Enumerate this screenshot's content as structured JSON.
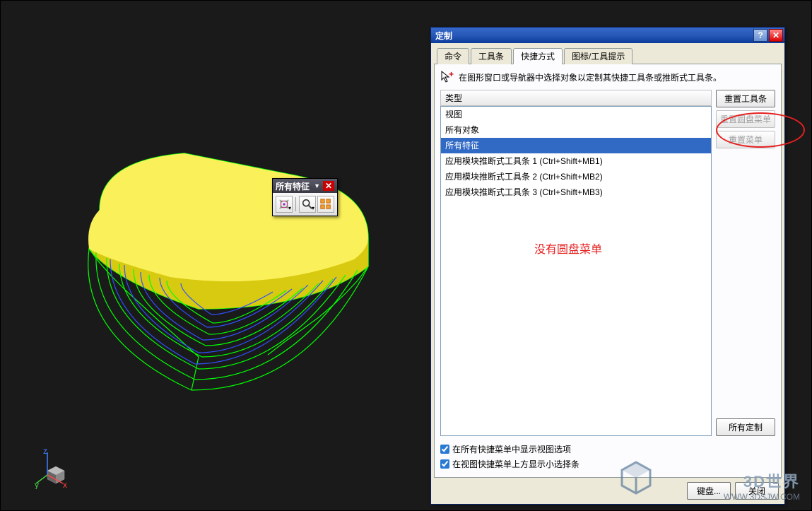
{
  "floatToolbar": {
    "title": "所有特征"
  },
  "dialog": {
    "title": "定制",
    "tabs": [
      "命令",
      "工具条",
      "快捷方式",
      "图标/工具提示"
    ],
    "activeTab": 2,
    "instruction": "在图形窗口或导航器中选择对象以定制其快捷工具条或推断式工具条。",
    "listHeader": "类型",
    "items": {
      "r0": "视图",
      "r1": "所有对象",
      "r2": "所有特征",
      "r3": "应用模块推断式工具条 1 (Ctrl+Shift+MB1)",
      "r4": "应用模块推断式工具条 2 (Ctrl+Shift+MB2)",
      "r5": "应用模块推断式工具条 3 (Ctrl+Shift+MB3)"
    },
    "buttons": {
      "resetToolbar": "重置工具条",
      "resetPie": "重置圆盘菜单",
      "resetMenu": "重置菜单",
      "allCustom": "所有定制"
    },
    "checks": {
      "c1": "在所有快捷菜单中显示视图选项",
      "c2": "在视图快捷菜单上方显示小选择条"
    },
    "footer": {
      "keyboard": "键盘...",
      "close": "关闭"
    }
  },
  "annotation": "没有圆盘菜单",
  "gizmo": {
    "x": "x",
    "y": "y",
    "z": "z"
  },
  "watermark": {
    "brand": "3D世界",
    "url": "WWW.3DSJW.COM"
  }
}
